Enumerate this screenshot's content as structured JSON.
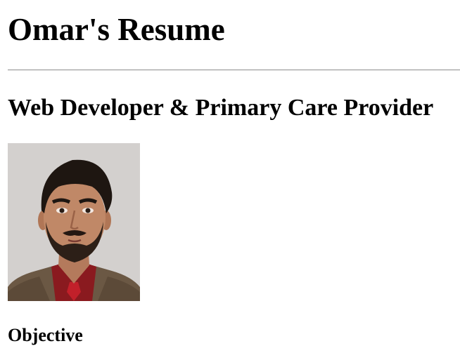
{
  "header": {
    "title": "Omar's Resume"
  },
  "profile": {
    "headline": "Web Developer & Primary Care Provider",
    "photo_icon": "portrait-photo"
  },
  "sections": {
    "objective": "Objective"
  }
}
